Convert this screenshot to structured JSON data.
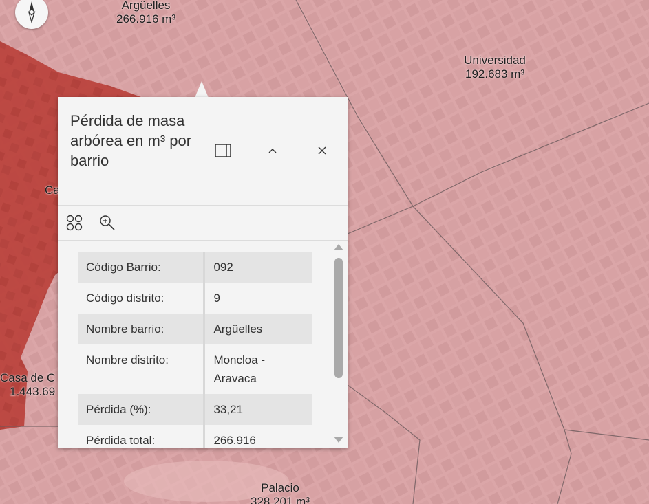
{
  "map": {
    "labels": [
      {
        "name": "Argüelles",
        "value": "266.916 m³"
      },
      {
        "name": "Universidad",
        "value": "192.683 m³"
      },
      {
        "name": "Palacio",
        "value": "328.201 m³"
      },
      {
        "name": "Casa de C",
        "value": "1.443.69"
      },
      {
        "name": "Ca",
        "value": ""
      }
    ],
    "colors": {
      "light_fill": "#d9a3a5",
      "dark_fill": "#b8403c",
      "boundary": "#6b5a5c"
    }
  },
  "compass": {
    "icon": "compass-icon"
  },
  "popup": {
    "title": "Pérdida de masa arbórea en m³ por barrio",
    "buttons": {
      "dock": "dock-icon",
      "collapse": "chevron-up-icon",
      "close": "close-icon"
    },
    "toolbar": {
      "features": "four-circles-icon",
      "zoom": "zoom-in-icon"
    },
    "attributes": [
      {
        "label": "Código Barrio:",
        "value": "092"
      },
      {
        "label": "Código distrito:",
        "value": "9"
      },
      {
        "label": "Nombre barrio:",
        "value": "Argüelles"
      },
      {
        "label": "Nombre distrito:",
        "value": "Moncloa - Aravaca"
      },
      {
        "label": "Pérdida (%):",
        "value": "33,21"
      },
      {
        "label": "Pérdida total:",
        "value": "266.916"
      }
    ]
  }
}
